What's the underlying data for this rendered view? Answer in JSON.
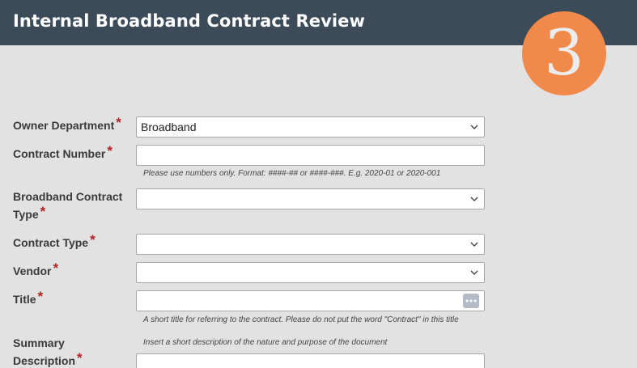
{
  "header": {
    "title": "Internal Broadband Contract Review"
  },
  "badge": {
    "number": "3"
  },
  "form": {
    "owner_department": {
      "label": "Owner Department",
      "required_mark": "*",
      "value": "Broadband"
    },
    "contract_number": {
      "label": "Contract Number",
      "required_mark": "*",
      "value": "",
      "hint": "Please use numbers only. Format: ####-## or ####-###. E.g. 2020-01 or 2020-001"
    },
    "broadband_contract_type": {
      "label_line1": "Broadband Contract",
      "label_line2": "Type",
      "required_mark": "*",
      "value": ""
    },
    "contract_type": {
      "label": "Contract Type",
      "required_mark": "*",
      "value": ""
    },
    "vendor": {
      "label": "Vendor",
      "required_mark": "*",
      "value": ""
    },
    "title": {
      "label": "Title",
      "required_mark": "*",
      "value": "",
      "hint": "A short title for referring to the contract. Please do not put the word \"Contract\" in this title"
    },
    "summary_description": {
      "label_line1": "Summary",
      "label_line2": "Description",
      "required_mark": "*",
      "hint": "Insert a short description of the nature and purpose of the document"
    }
  },
  "icons": {
    "dropdown": "chevron-down-icon",
    "more": "more-dots-icon"
  },
  "colors": {
    "header_bg": "#3c4b5a",
    "badge_bg": "#f0894a",
    "required": "#b22222",
    "page_bg": "#e2e2e2"
  }
}
